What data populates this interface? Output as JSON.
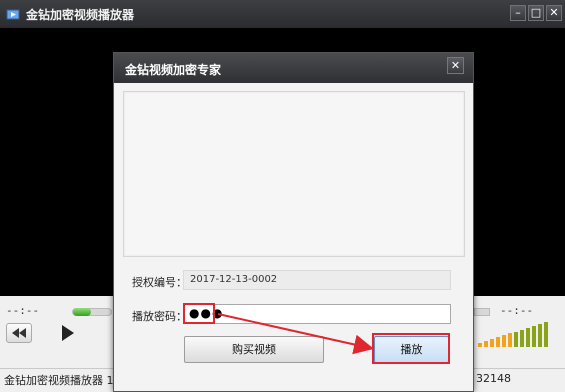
{
  "window": {
    "title": "金钻加密视频播放器",
    "min_glyph": "–",
    "max_glyph": "□",
    "close_glyph": "✕"
  },
  "player": {
    "time_left": "--:--",
    "time_right": "--:--",
    "status_left": "金钻加密视频播放器 1.3版",
    "status_right": "32148",
    "seek_progress": 0.0,
    "volume_level": 1.0
  },
  "dialog": {
    "title": "金钻视频加密专家",
    "close_glyph": "✕",
    "auth_label": "授权编号：",
    "auth_value": "2017-12-13-0002",
    "password_label": "播放密码：",
    "password_value": "●●●",
    "buy_button": "购买视频",
    "play_button": "播放"
  },
  "colors": {
    "highlight": "#e0262e",
    "seek_knob": "#3a9b24",
    "volume_low": "#f2a31b",
    "volume_high": "#8aa31a"
  }
}
